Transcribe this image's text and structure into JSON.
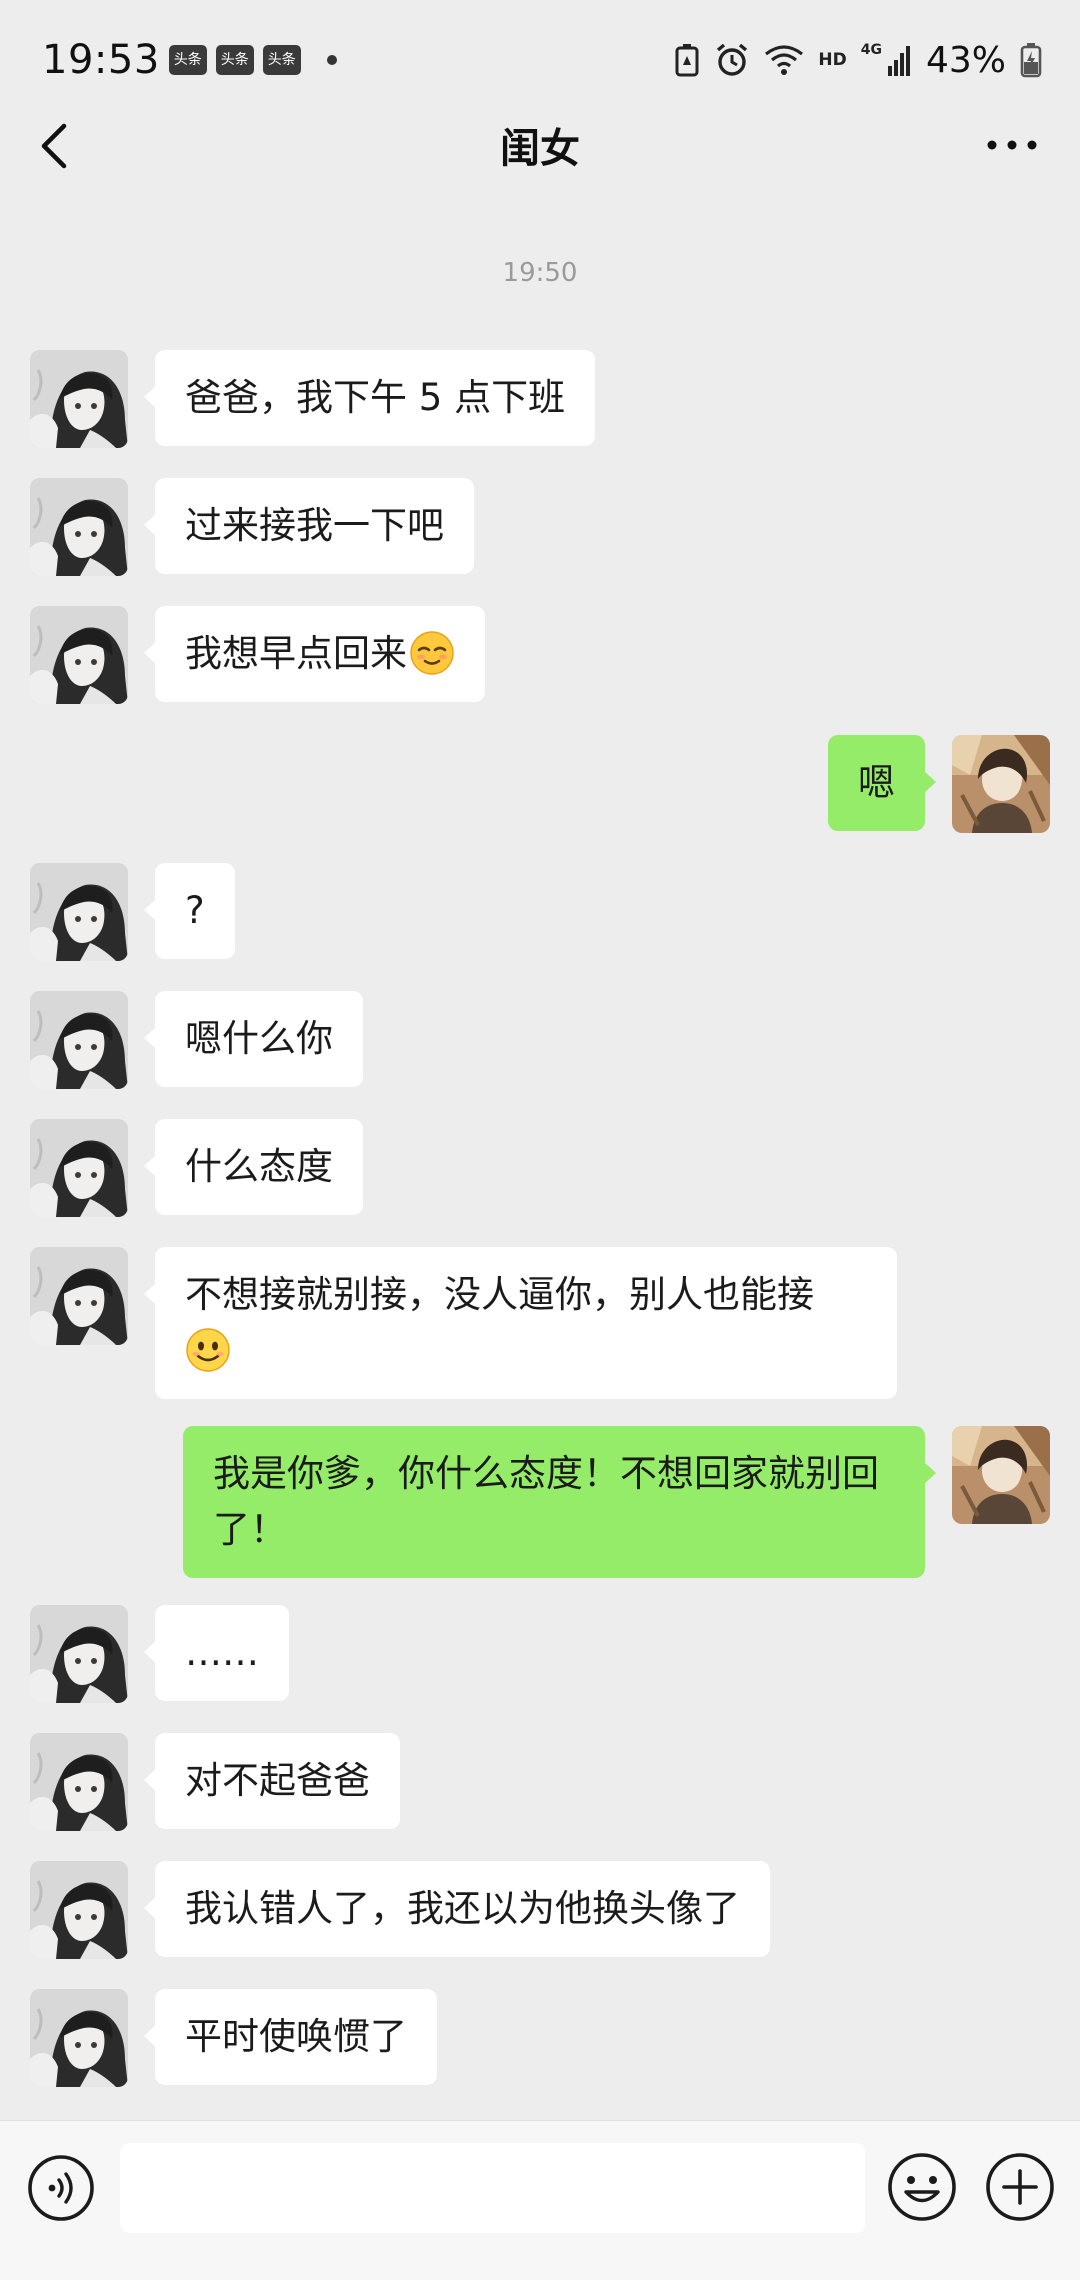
{
  "status_bar": {
    "time": "19:53",
    "news_badges": [
      "头条",
      "头条",
      "头条"
    ],
    "network_hd": "HD",
    "network_4g": "4G",
    "battery_percent": "43%"
  },
  "nav": {
    "title": "闺女"
  },
  "chat": {
    "timestamp": "19:50",
    "messages": [
      {
        "from": "daughter",
        "text": "爸爸，我下午 5 点下班"
      },
      {
        "from": "daughter",
        "text": "过来接我一下吧"
      },
      {
        "from": "daughter",
        "text": "我想早点回来",
        "emoji": "relieved-face"
      },
      {
        "from": "me",
        "text": "嗯"
      },
      {
        "from": "daughter",
        "text": "?"
      },
      {
        "from": "daughter",
        "text": "嗯什么你"
      },
      {
        "from": "daughter",
        "text": "什么态度"
      },
      {
        "from": "daughter",
        "text": "不想接就别接，没人逼你，别人也能接",
        "emoji": "smiling-face"
      },
      {
        "from": "me",
        "text": "我是你爹，你什么态度！不想回家就别回了！"
      },
      {
        "from": "daughter",
        "text": "……"
      },
      {
        "from": "daughter",
        "text": "对不起爸爸"
      },
      {
        "from": "daughter",
        "text": "我认错人了，我还以为他换头像了"
      },
      {
        "from": "daughter",
        "text": "平时使唤惯了"
      }
    ]
  },
  "input_bar": {
    "text_value": "",
    "voice_icon": "voice-icon",
    "emoji_icon": "emoji-icon",
    "plus_icon": "plus-icon"
  },
  "colors": {
    "background": "#ededed",
    "bubble_incoming": "#ffffff",
    "bubble_outgoing": "#95ec69",
    "timestamp": "#9a9a9a"
  }
}
